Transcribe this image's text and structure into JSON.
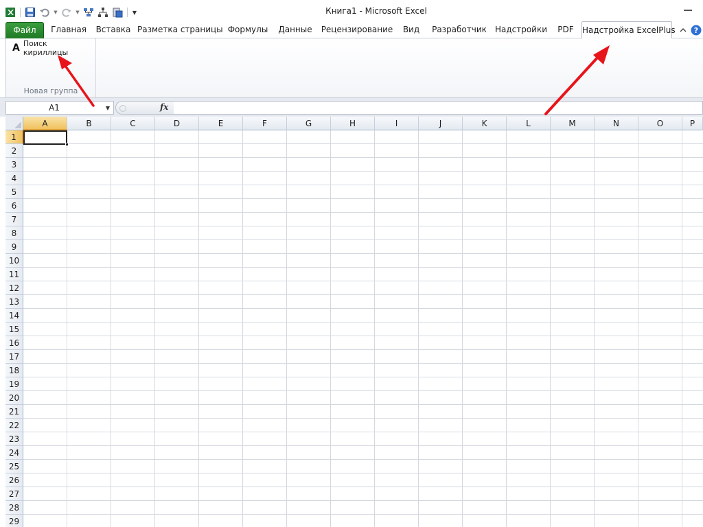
{
  "window": {
    "title": "Книга1  -  Microsoft Excel"
  },
  "qat": {
    "icons": [
      "excel-logo-icon",
      "save-icon",
      "undo-icon",
      "redo-icon",
      "connector-icon",
      "hierarchy-icon",
      "paste-special-icon",
      "customize-qat-icon"
    ]
  },
  "tabs": [
    {
      "label": "Файл"
    },
    {
      "label": "Главная"
    },
    {
      "label": "Вставка"
    },
    {
      "label": "Разметка страницы"
    },
    {
      "label": "Формулы"
    },
    {
      "label": "Данные"
    },
    {
      "label": "Рецензирование"
    },
    {
      "label": "Вид"
    },
    {
      "label": "Разработчик"
    },
    {
      "label": "Надстройки"
    },
    {
      "label": "PDF"
    },
    {
      "label": "Надстройка ExcelPlus"
    }
  ],
  "active_tab": "Надстройка ExcelPlus",
  "ribbon": {
    "group_label": "Новая группа",
    "button_icon_letter": "A",
    "button_label": "Поиск кириллицы"
  },
  "formula_bar": {
    "name_box": "A1",
    "fx_label": "fx",
    "formula_value": ""
  },
  "sheet": {
    "columns": [
      "A",
      "B",
      "C",
      "D",
      "E",
      "F",
      "G",
      "H",
      "I",
      "J",
      "K",
      "L",
      "M",
      "N",
      "O",
      "P"
    ],
    "rows": [
      "1",
      "2",
      "3",
      "4",
      "5",
      "6",
      "7",
      "8",
      "9",
      "10",
      "11",
      "12",
      "13",
      "14",
      "15",
      "16",
      "17",
      "18",
      "19",
      "20",
      "21",
      "22",
      "23",
      "24",
      "25",
      "26",
      "27",
      "28",
      "29"
    ],
    "selected_column": "A",
    "selected_row": "1"
  },
  "colors": {
    "file_tab": "#2b8a33",
    "selection_header": "#f1c15f",
    "annotation_arrow": "#e8141b",
    "help_icon": "#2f6fd6"
  }
}
